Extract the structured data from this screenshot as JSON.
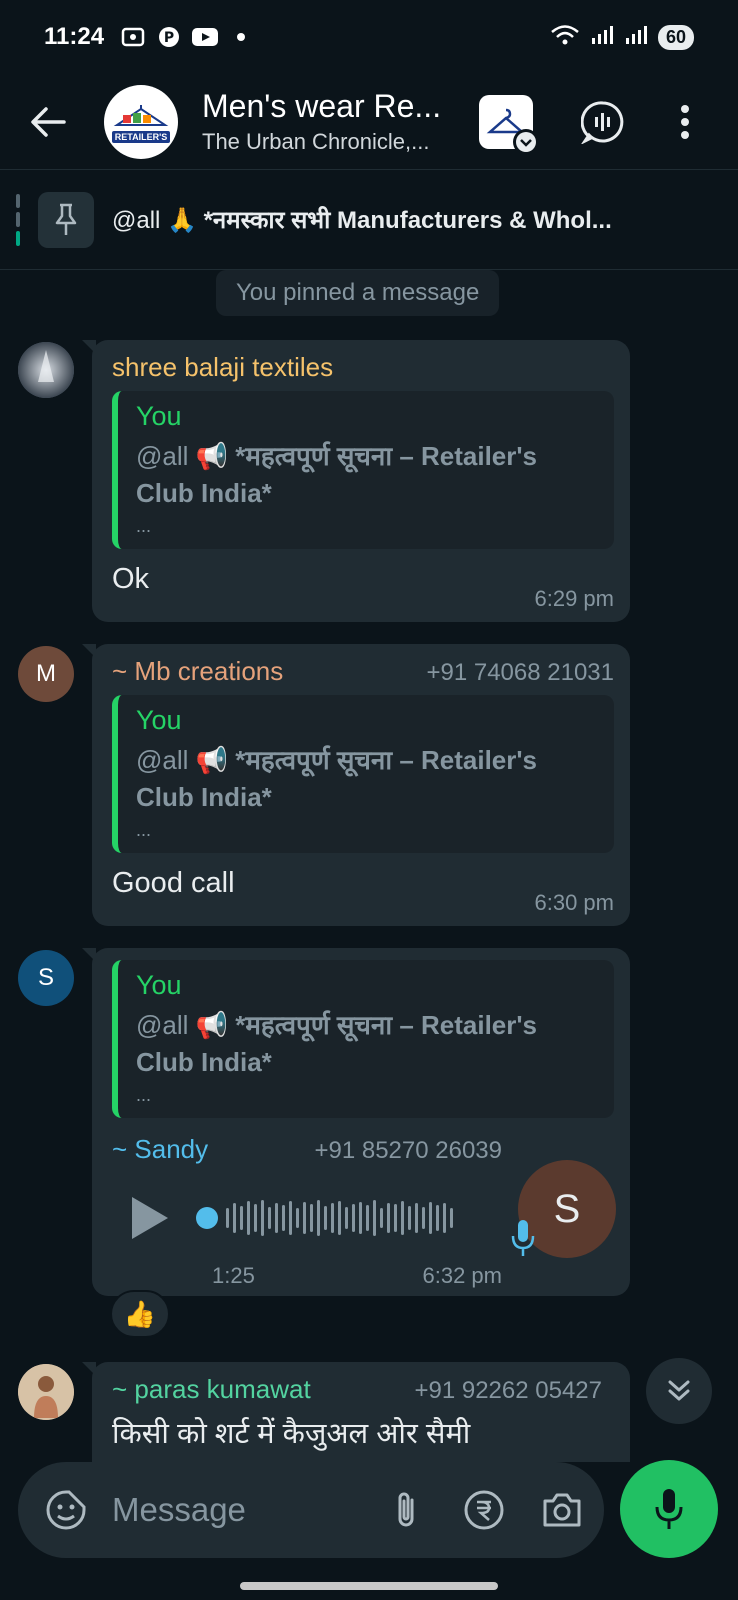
{
  "status_bar": {
    "time": "11:24",
    "battery": "60"
  },
  "header": {
    "title": "Men's wear Re...",
    "subtitle": "The Urban Chronicle,...",
    "avatar_logo_text": "RC RETAILER'S CLUB"
  },
  "pinned": {
    "text_prefix": "@all 🙏 ",
    "text_bold": "*नमस्कार सभी Manufacturers & Whol..."
  },
  "system_message": "You pinned a message",
  "messages": [
    {
      "sender": "shree balaji textiles",
      "phone": "",
      "quote_author": "You",
      "quote_text_prefix": "@all 📢 ",
      "quote_text_bold": "*महत्वपूर्ण सूचना – Retailer's Club India*",
      "quote_more": "...",
      "text": "Ok",
      "time": "6:29 pm"
    },
    {
      "avatar_letter": "M",
      "sender": "~ Mb creations",
      "phone": "+91 74068 21031",
      "quote_author": "You",
      "quote_text_prefix": "@all 📢 ",
      "quote_text_bold": "*महत्वपूर्ण सूचना – Retailer's Club India*",
      "quote_more": "...",
      "text": "Good call",
      "time": "6:30 pm"
    },
    {
      "avatar_letter": "S",
      "quote_author": "You",
      "quote_text_prefix": "@all 📢 ",
      "quote_text_bold": "*महत्वपूर्ण सूचना – Retailer's Club India*",
      "quote_more": "...",
      "sender": "~ Sandy",
      "phone": "+91 85270 26039",
      "voice_duration": "1:25",
      "voice_avatar_letter": "S",
      "time": "6:32 pm",
      "reaction": "👍"
    },
    {
      "sender": "~ paras kumawat",
      "phone": "+91 92262 05427",
      "text": "किसी को शर्ट में कैजुअल ओर सैमी"
    }
  ],
  "input": {
    "placeholder": "Message"
  },
  "colors": {
    "accent": "#21c063",
    "background": "#0b141a",
    "bubble": "#202c33"
  }
}
